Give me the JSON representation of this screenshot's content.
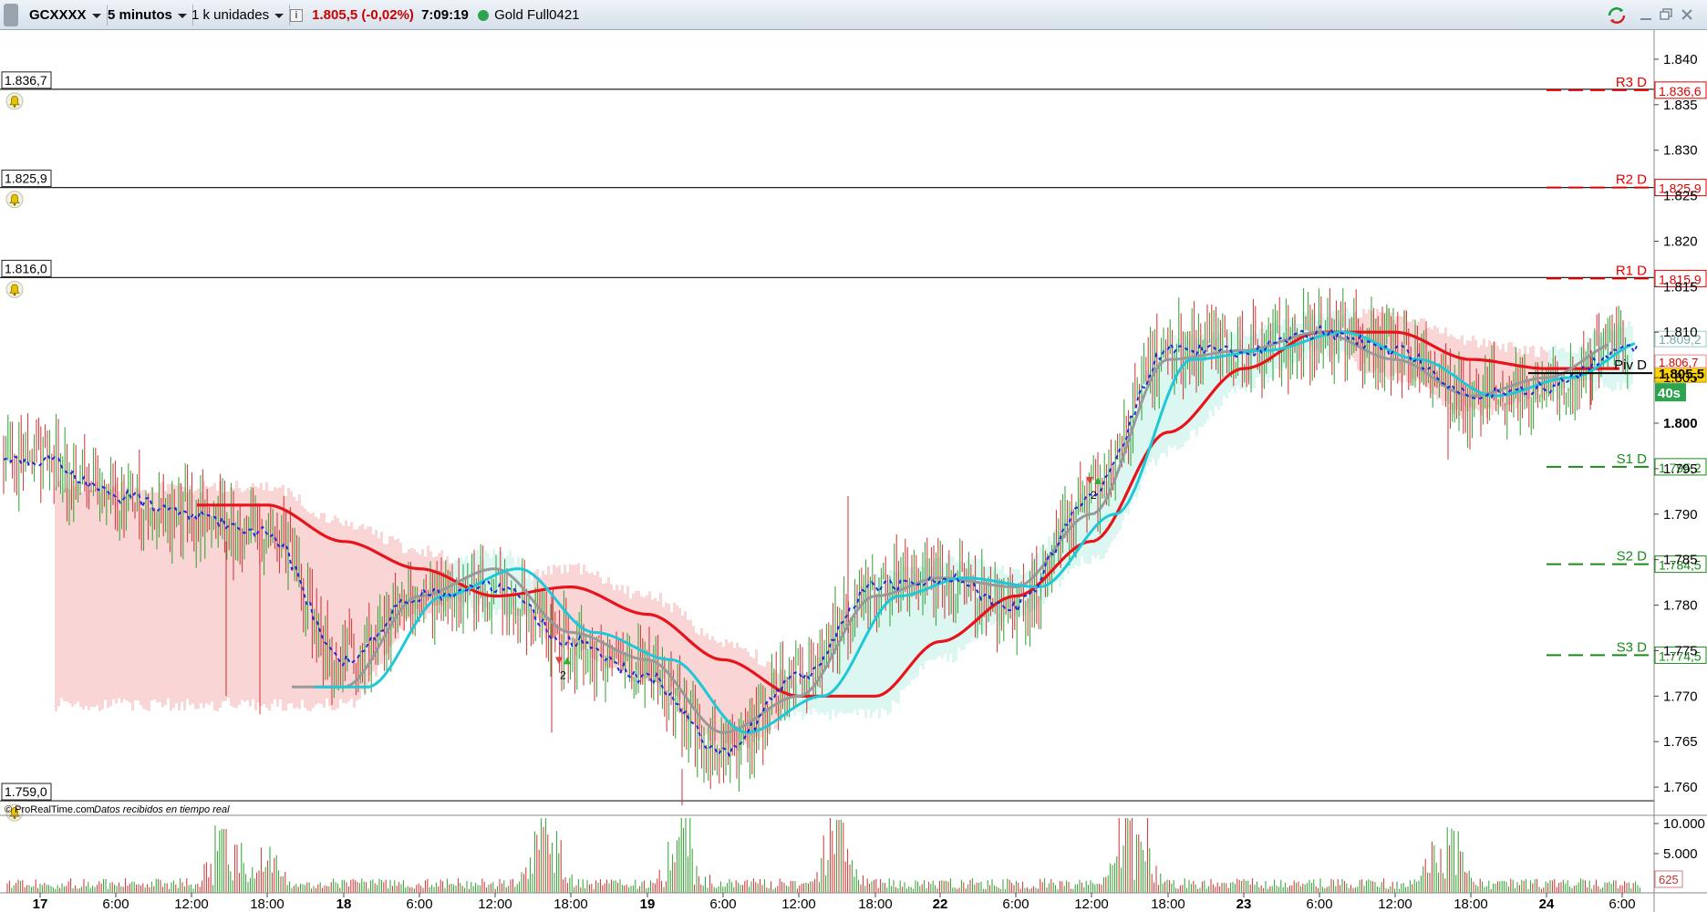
{
  "toolbar": {
    "symbol": "GCXXXX",
    "timeframe": "5 minutos",
    "units": "1 k unidades",
    "price_change": "1.805,5 (-0,02%)",
    "time": "7:09:19",
    "instrument": "Gold Full0421",
    "colors": {
      "price_change": "#cc0000",
      "status_dot": "#2ea44f"
    }
  },
  "chart": {
    "credit": "© ProRealTime.com",
    "credit_note": "Datos recibidos en tiempo real",
    "price_axis_ticks": [
      "1.840",
      "1.835",
      "1.830",
      "1.825",
      "1.820",
      "1.815",
      "1.810",
      "1.805",
      "1.800",
      "1.795",
      "1.790",
      "1.785",
      "1.780",
      "1.775",
      "1.770",
      "1.765",
      "1.760"
    ],
    "volume_axis_ticks": [
      "10.000",
      "5.000"
    ],
    "volume_last": "625",
    "x_labels": [
      {
        "text": "17",
        "bold": true
      },
      {
        "text": "6:00"
      },
      {
        "text": "12:00"
      },
      {
        "text": "18:00"
      },
      {
        "text": "18",
        "bold": true
      },
      {
        "text": "6:00"
      },
      {
        "text": "12:00"
      },
      {
        "text": "18:00"
      },
      {
        "text": "19",
        "bold": true
      },
      {
        "text": "6:00"
      },
      {
        "text": "12:00"
      },
      {
        "text": "18:00"
      },
      {
        "text": "22",
        "bold": true
      },
      {
        "text": "6:00"
      },
      {
        "text": "12:00"
      },
      {
        "text": "18:00"
      },
      {
        "text": "23",
        "bold": true
      },
      {
        "text": "6:00"
      },
      {
        "text": "12:00"
      },
      {
        "text": "18:00"
      },
      {
        "text": "24",
        "bold": true
      },
      {
        "text": "6:00"
      }
    ],
    "horizontal_lines": [
      {
        "label": "1.836,7",
        "value": 1836.7
      },
      {
        "label": "1.825,9",
        "value": 1825.9
      },
      {
        "label": "1.816,0",
        "value": 1816.0
      },
      {
        "label": "1.759,0",
        "value": 1759.0
      }
    ],
    "pivots": [
      {
        "name": "R3 D",
        "value_label": "1.836,6",
        "value": 1836.6,
        "color": "#e00000"
      },
      {
        "name": "R2 D",
        "value_label": "1.825,9",
        "value": 1825.9,
        "color": "#e00000"
      },
      {
        "name": "R1 D",
        "value_label": "1.815,9",
        "value": 1815.9,
        "color": "#e00000"
      },
      {
        "name": "Piv D",
        "value_label": "1.805,5",
        "value": 1805.5,
        "color": "#000000"
      },
      {
        "name": "S1 D",
        "value_label": "1.795,2",
        "value": 1795.2,
        "color": "#1a8a1a"
      },
      {
        "name": "S2 D",
        "value_label": "1.784,5",
        "value": 1784.5,
        "color": "#1a8a1a"
      },
      {
        "name": "S3 D",
        "value_label": "1.774,5",
        "value": 1774.5,
        "color": "#1a8a1a"
      }
    ],
    "current_price": {
      "label": "1.805,5",
      "countdown": "40s"
    },
    "ma_labels": [
      "1.809,2",
      "1.806,7"
    ],
    "trade_markers": [
      "2",
      "2",
      "2"
    ],
    "colors": {
      "up_candle": "#2ea02e",
      "down_candle": "#d03030",
      "ma_red": "#e8141c",
      "ma_cyan": "#1ec8d6",
      "ma_gray": "#999999",
      "dotted": "#1530d8",
      "cloud_green": "#cdf3ec",
      "cloud_red": "#f7c3c3"
    }
  },
  "chart_data": {
    "type": "line",
    "title": "GCXXXX",
    "ylim": [
      1757,
      1843
    ],
    "x": [
      "17",
      "17 6:00",
      "17 12:00",
      "17 18:00",
      "18",
      "18 6:00",
      "18 12:00",
      "18 18:00",
      "19",
      "19 6:00",
      "19 12:00",
      "19 18:00",
      "22",
      "22 6:00",
      "22 12:00",
      "22 18:00",
      "23",
      "23 6:00",
      "23 12:00",
      "23 18:00",
      "24",
      "24 6:00"
    ],
    "series": [
      {
        "values": [
          1796,
          1792,
          1790,
          1788,
          1774,
          1781,
          1782,
          1776,
          1772,
          1764,
          1772,
          1782,
          1783,
          1780,
          1792,
          1808,
          1808,
          1810,
          1808,
          1803,
          1804,
          1808
        ]
      },
      {
        "values": [
          null,
          null,
          null,
          1791,
          1787,
          1784,
          1781,
          1782,
          1779,
          1774,
          1770,
          1770,
          1776,
          1781,
          1787,
          1799,
          1806,
          1810,
          1810,
          1807,
          1806,
          1806
        ]
      },
      {
        "values": [
          null,
          null,
          null,
          null,
          1771,
          1781,
          1784,
          1777,
          1774,
          1766,
          1770,
          1781,
          1783,
          1782,
          1790,
          1807,
          1808,
          1810,
          1807,
          1803,
          1805,
          1809
        ]
      }
    ]
  }
}
